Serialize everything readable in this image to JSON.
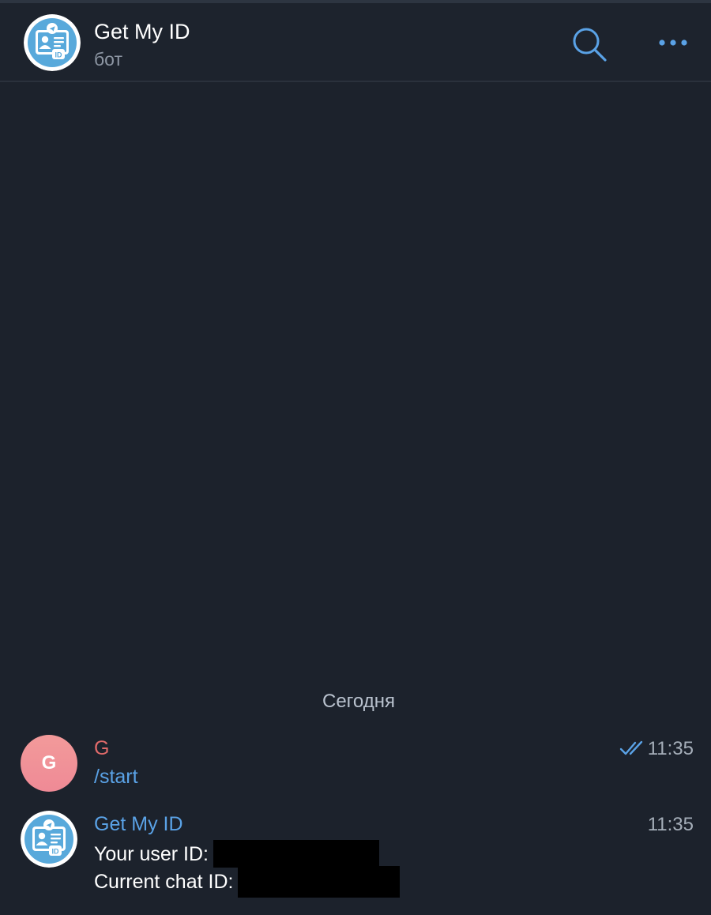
{
  "colors": {
    "background": "#1c222c",
    "header_background": "#1d232d",
    "accent": "#5aa2e6",
    "user_name": "#e06a6a",
    "avatar_blue": "#58a9db",
    "text_primary": "#ffffff",
    "text_secondary": "#8d96a3"
  },
  "header": {
    "title": "Get My ID",
    "subtitle": "бот",
    "avatar_icon": "id-card-icon",
    "search_icon": "search-icon",
    "more_icon": "more-horizontal-icon"
  },
  "chat": {
    "date_separator": "Сегодня",
    "messages": [
      {
        "sender": "G",
        "avatar_letter": "G",
        "text": "/start",
        "time": "11:35",
        "status_icon": "double-check-icon"
      },
      {
        "sender": "Get My ID",
        "avatar_icon": "id-card-icon",
        "lines": [
          {
            "label": "Your user ID:",
            "value_redacted": true
          },
          {
            "label": "Current chat ID:",
            "value_redacted": true
          }
        ],
        "time": "11:35"
      }
    ]
  }
}
